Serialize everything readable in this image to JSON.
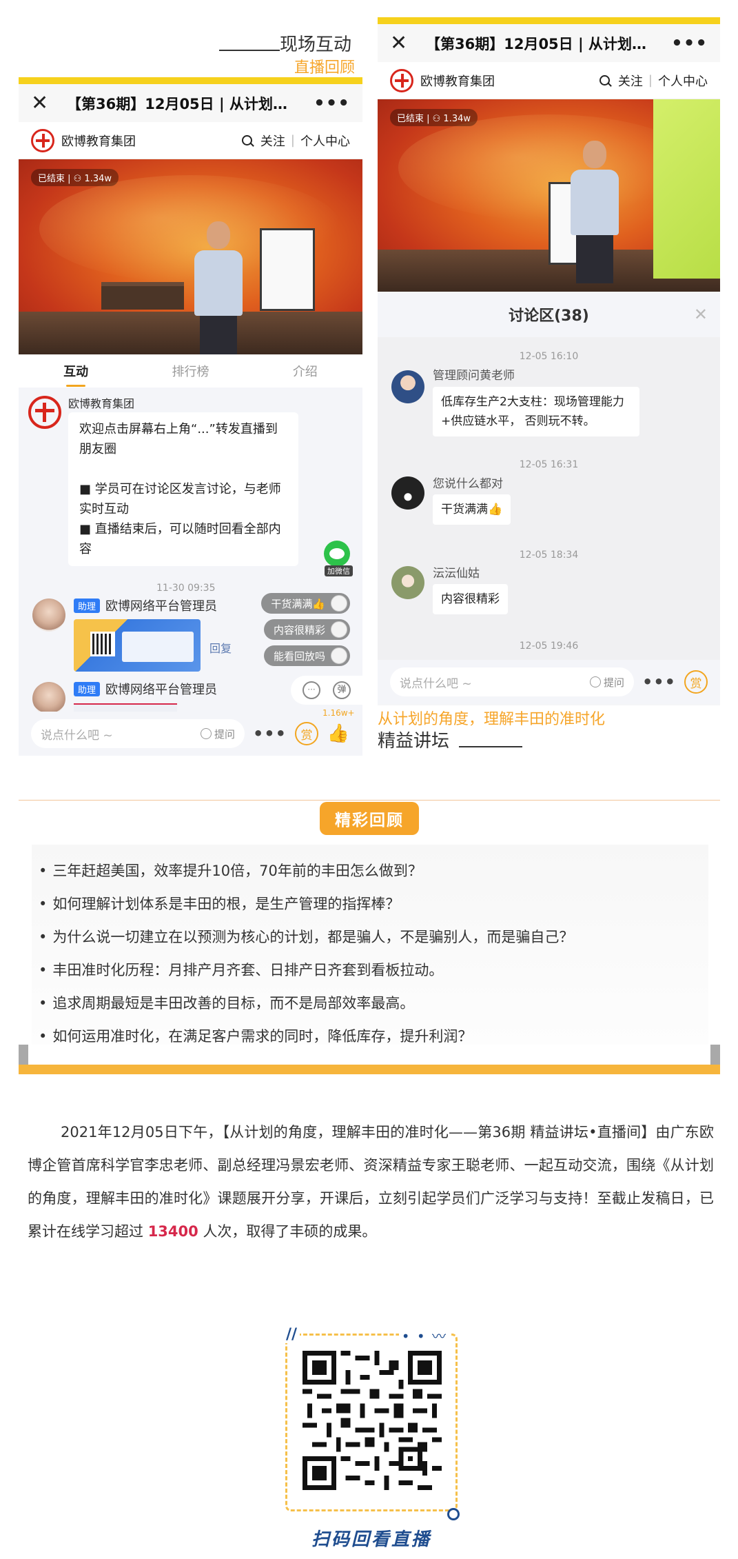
{
  "captions": {
    "left_title": "现场互动",
    "left_subtitle": "直播回顾",
    "right_subtitle": "从计划的角度，理解丰田的准时化",
    "right_title": "精益讲坛"
  },
  "left_phone": {
    "window_title": "【第36期】12月05日 | 从计划的角...",
    "brand": "欧博教育集团",
    "follow": "关注",
    "personal_center": "个人中心",
    "video_badge": "已结束 | ⚇ 1.34w",
    "tabs": [
      "互动",
      "排行榜",
      "介绍"
    ],
    "pinned": {
      "sender": "欧博教育集团",
      "text1": "欢迎点击屏幕右上角“...”转发直播到朋友圈",
      "text2": "■ 学员可在讨论区发言讨论，与老师实时互动",
      "text3": "■ 直播结束后，可以随时回看全部内容"
    },
    "wechat_label": "加微信",
    "timestamp": "11-30 09:35",
    "assist_tag": "助理",
    "admin_name": "欧博网络平台管理员",
    "reply": "回复",
    "floating": [
      "干货满满👍",
      "内容很精彩",
      "能看回放吗"
    ],
    "input_placeholder": "说点什么吧 ~",
    "ask_label": "提问",
    "reward_label": "赏",
    "like_count": "1.16w+",
    "danmaku_label": "弹"
  },
  "right_phone": {
    "window_title": "【第36期】12月05日 | 从计划的角...",
    "brand": "欧博教育集团",
    "follow": "关注",
    "personal_center": "个人中心",
    "video_badge": "已结束 | ⚇ 1.34w",
    "discussion_title": "讨论区(38)",
    "messages": [
      {
        "time": "12-05 16:10",
        "name": "管理顾问黄老师",
        "text": "低库存生产2大支柱：现场管理能力+供应链水平， 否则玩不转。"
      },
      {
        "time": "12-05 16:31",
        "name": "您说什么都对",
        "text": "干货满满👍"
      },
      {
        "time": "12-05 18:34",
        "name": "沄沄仙姑",
        "text": "内容很精彩"
      },
      {
        "time": "12-05 19:46",
        "name": "",
        "text": ""
      }
    ],
    "input_placeholder": "说点什么吧 ~",
    "ask_label": "提问",
    "reward_label": "赏"
  },
  "highlights": {
    "badge": "精彩回顾",
    "items": [
      "三年赶超美国，效率提升10倍，70年前的丰田怎么做到？",
      "如何理解计划体系是丰田的根，是生产管理的指挥棒？",
      "为什么说一切建立在以预测为核心的计划，都是骗人，不是骗别人，而是骗自己？",
      "丰田准时化历程：月排产月齐套、日排产日齐套到看板拉动。",
      "追求周期最短是丰田改善的目标，而不是局部效率最高。",
      "如何运用准时化，在满足客户需求的同时，降低库存，提升利润？"
    ]
  },
  "summary": {
    "before": "2021年12月05日下午，【从计划的角度，理解丰田的准时化——第36期 精益讲坛•直播间】由广东欧博企管首席科学官李忠老师、副总经理冯景宏老师、资深精益专家王聪老师、一起互动交流，围绕《从计划的角度，理解丰田的准时化》课题展开分享，开课后，立刻引起学员们广泛学习与支持！至截止发稿日，已累计在线学习超过",
    "count": "13400",
    "after": "人次，取得了丰硕的成果。"
  },
  "qr": {
    "caption": "扫码回看直播"
  },
  "colors": {
    "accent_orange": "#f6a52a",
    "accent_yellow": "#f6d11c",
    "highlight_red": "#d6284b",
    "caption_blue": "#1f4d8f"
  }
}
